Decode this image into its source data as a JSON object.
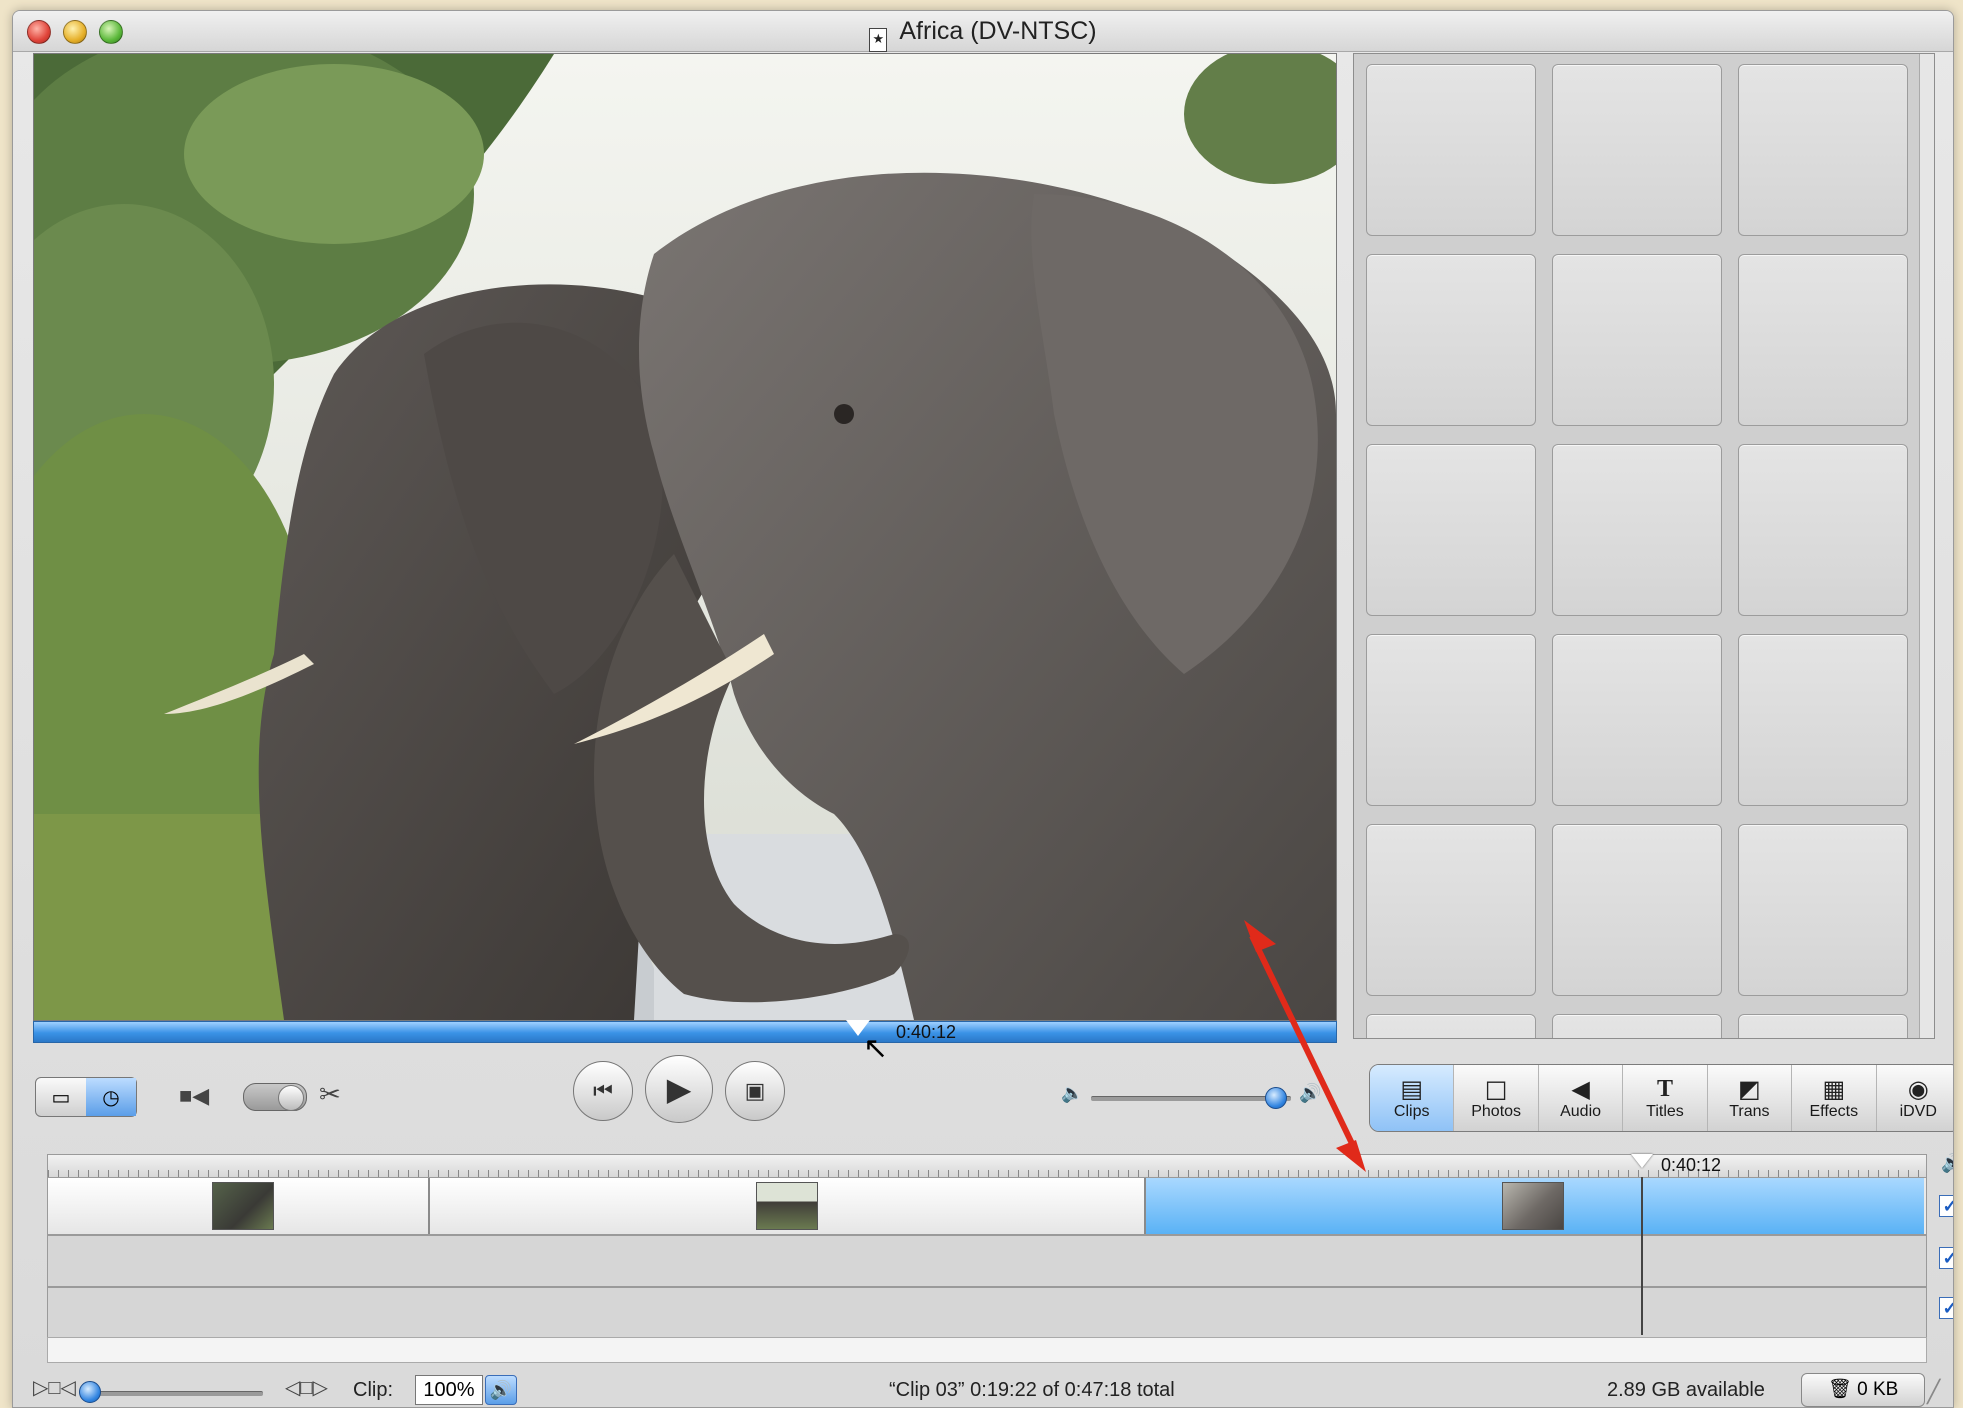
{
  "window": {
    "title": "Africa (DV-NTSC)"
  },
  "viewer": {
    "playhead_time": "0:40:12",
    "playhead_fraction": 0.63
  },
  "transport": {
    "volume_fraction": 0.95
  },
  "pane_tabs": [
    {
      "label": "Clips",
      "icon": "clips-icon",
      "active": true
    },
    {
      "label": "Photos",
      "icon": "photos-icon",
      "active": false
    },
    {
      "label": "Audio",
      "icon": "audio-icon",
      "active": false
    },
    {
      "label": "Titles",
      "icon": "titles-icon",
      "active": false
    },
    {
      "label": "Trans",
      "icon": "trans-icon",
      "active": false
    },
    {
      "label": "Effects",
      "icon": "effects-icon",
      "active": false
    },
    {
      "label": "iDVD",
      "icon": "idvd-icon",
      "active": false
    }
  ],
  "timeline": {
    "playhead_time": "0:40:12",
    "clips": [
      {
        "thumb": "elephant-head"
      },
      {
        "thumb": "elephants-road"
      },
      {
        "thumb": "elephants-closeup",
        "selected": true
      }
    ],
    "tracks_enabled": [
      true,
      true,
      true
    ]
  },
  "status_bar": {
    "clip_label": "Clip:",
    "clip_volume": "100%",
    "info": "“Clip 03”  0:19:22 of 0:47:18 total",
    "disk_space": "2.89 GB available",
    "trash_size": "0 KB"
  },
  "colors": {
    "accent": "#3a92e6",
    "arrow": "#e02a1a"
  }
}
